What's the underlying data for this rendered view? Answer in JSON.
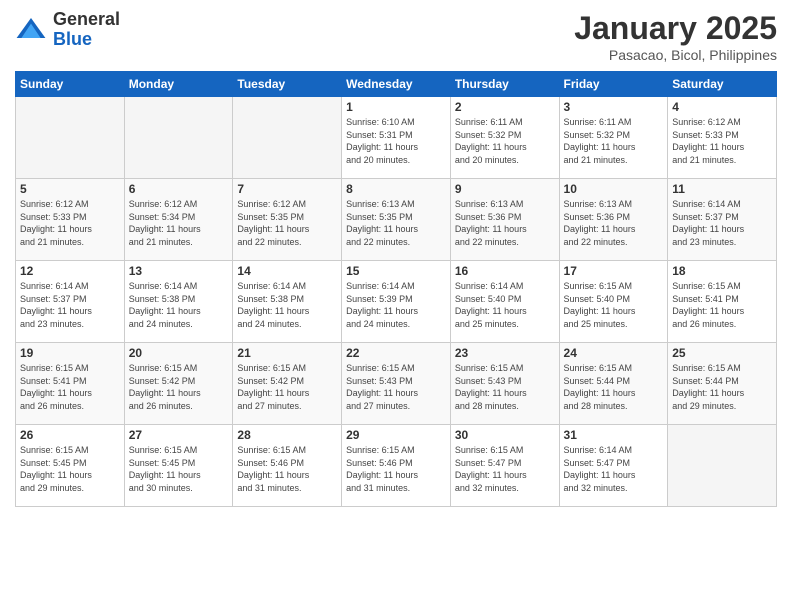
{
  "header": {
    "logo_line1": "General",
    "logo_line2": "Blue",
    "month": "January 2025",
    "location": "Pasacao, Bicol, Philippines"
  },
  "days_of_week": [
    "Sunday",
    "Monday",
    "Tuesday",
    "Wednesday",
    "Thursday",
    "Friday",
    "Saturday"
  ],
  "weeks": [
    [
      {
        "num": "",
        "info": ""
      },
      {
        "num": "",
        "info": ""
      },
      {
        "num": "",
        "info": ""
      },
      {
        "num": "1",
        "info": "Sunrise: 6:10 AM\nSunset: 5:31 PM\nDaylight: 11 hours\nand 20 minutes."
      },
      {
        "num": "2",
        "info": "Sunrise: 6:11 AM\nSunset: 5:32 PM\nDaylight: 11 hours\nand 20 minutes."
      },
      {
        "num": "3",
        "info": "Sunrise: 6:11 AM\nSunset: 5:32 PM\nDaylight: 11 hours\nand 21 minutes."
      },
      {
        "num": "4",
        "info": "Sunrise: 6:12 AM\nSunset: 5:33 PM\nDaylight: 11 hours\nand 21 minutes."
      }
    ],
    [
      {
        "num": "5",
        "info": "Sunrise: 6:12 AM\nSunset: 5:33 PM\nDaylight: 11 hours\nand 21 minutes."
      },
      {
        "num": "6",
        "info": "Sunrise: 6:12 AM\nSunset: 5:34 PM\nDaylight: 11 hours\nand 21 minutes."
      },
      {
        "num": "7",
        "info": "Sunrise: 6:12 AM\nSunset: 5:35 PM\nDaylight: 11 hours\nand 22 minutes."
      },
      {
        "num": "8",
        "info": "Sunrise: 6:13 AM\nSunset: 5:35 PM\nDaylight: 11 hours\nand 22 minutes."
      },
      {
        "num": "9",
        "info": "Sunrise: 6:13 AM\nSunset: 5:36 PM\nDaylight: 11 hours\nand 22 minutes."
      },
      {
        "num": "10",
        "info": "Sunrise: 6:13 AM\nSunset: 5:36 PM\nDaylight: 11 hours\nand 22 minutes."
      },
      {
        "num": "11",
        "info": "Sunrise: 6:14 AM\nSunset: 5:37 PM\nDaylight: 11 hours\nand 23 minutes."
      }
    ],
    [
      {
        "num": "12",
        "info": "Sunrise: 6:14 AM\nSunset: 5:37 PM\nDaylight: 11 hours\nand 23 minutes."
      },
      {
        "num": "13",
        "info": "Sunrise: 6:14 AM\nSunset: 5:38 PM\nDaylight: 11 hours\nand 24 minutes."
      },
      {
        "num": "14",
        "info": "Sunrise: 6:14 AM\nSunset: 5:38 PM\nDaylight: 11 hours\nand 24 minutes."
      },
      {
        "num": "15",
        "info": "Sunrise: 6:14 AM\nSunset: 5:39 PM\nDaylight: 11 hours\nand 24 minutes."
      },
      {
        "num": "16",
        "info": "Sunrise: 6:14 AM\nSunset: 5:40 PM\nDaylight: 11 hours\nand 25 minutes."
      },
      {
        "num": "17",
        "info": "Sunrise: 6:15 AM\nSunset: 5:40 PM\nDaylight: 11 hours\nand 25 minutes."
      },
      {
        "num": "18",
        "info": "Sunrise: 6:15 AM\nSunset: 5:41 PM\nDaylight: 11 hours\nand 26 minutes."
      }
    ],
    [
      {
        "num": "19",
        "info": "Sunrise: 6:15 AM\nSunset: 5:41 PM\nDaylight: 11 hours\nand 26 minutes."
      },
      {
        "num": "20",
        "info": "Sunrise: 6:15 AM\nSunset: 5:42 PM\nDaylight: 11 hours\nand 26 minutes."
      },
      {
        "num": "21",
        "info": "Sunrise: 6:15 AM\nSunset: 5:42 PM\nDaylight: 11 hours\nand 27 minutes."
      },
      {
        "num": "22",
        "info": "Sunrise: 6:15 AM\nSunset: 5:43 PM\nDaylight: 11 hours\nand 27 minutes."
      },
      {
        "num": "23",
        "info": "Sunrise: 6:15 AM\nSunset: 5:43 PM\nDaylight: 11 hours\nand 28 minutes."
      },
      {
        "num": "24",
        "info": "Sunrise: 6:15 AM\nSunset: 5:44 PM\nDaylight: 11 hours\nand 28 minutes."
      },
      {
        "num": "25",
        "info": "Sunrise: 6:15 AM\nSunset: 5:44 PM\nDaylight: 11 hours\nand 29 minutes."
      }
    ],
    [
      {
        "num": "26",
        "info": "Sunrise: 6:15 AM\nSunset: 5:45 PM\nDaylight: 11 hours\nand 29 minutes."
      },
      {
        "num": "27",
        "info": "Sunrise: 6:15 AM\nSunset: 5:45 PM\nDaylight: 11 hours\nand 30 minutes."
      },
      {
        "num": "28",
        "info": "Sunrise: 6:15 AM\nSunset: 5:46 PM\nDaylight: 11 hours\nand 31 minutes."
      },
      {
        "num": "29",
        "info": "Sunrise: 6:15 AM\nSunset: 5:46 PM\nDaylight: 11 hours\nand 31 minutes."
      },
      {
        "num": "30",
        "info": "Sunrise: 6:15 AM\nSunset: 5:47 PM\nDaylight: 11 hours\nand 32 minutes."
      },
      {
        "num": "31",
        "info": "Sunrise: 6:14 AM\nSunset: 5:47 PM\nDaylight: 11 hours\nand 32 minutes."
      },
      {
        "num": "",
        "info": ""
      }
    ]
  ]
}
